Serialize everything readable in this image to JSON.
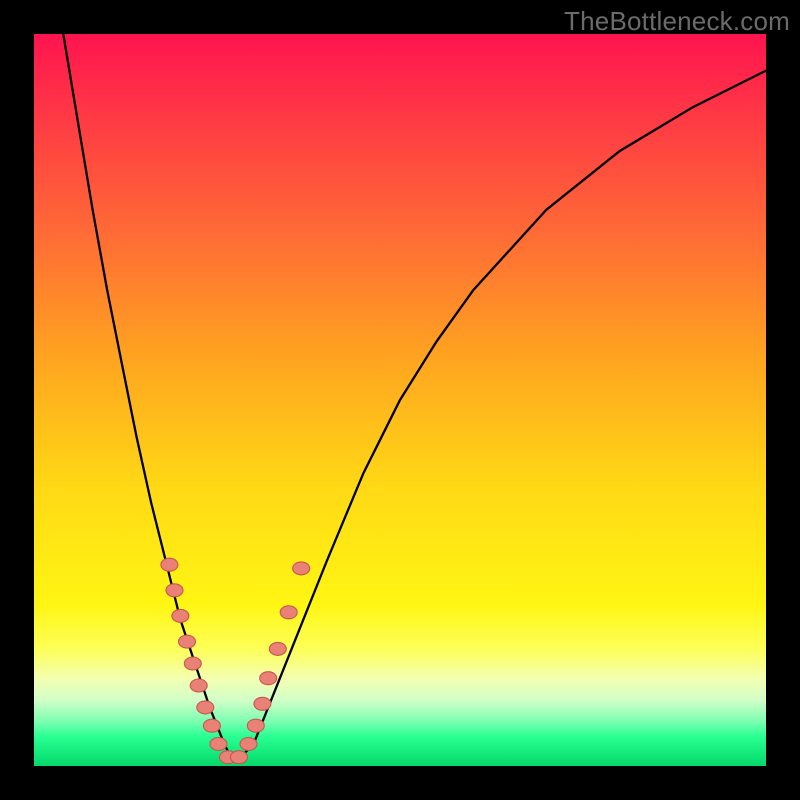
{
  "watermark": "TheBottleneck.com",
  "colors": {
    "frame": "#000000",
    "gradient_top": "#ff144f",
    "gradient_bottom": "#04d86a",
    "curve": "#000000",
    "bead_fill": "#e98177",
    "bead_stroke": "#c4584f"
  },
  "chart_data": {
    "type": "line",
    "title": "",
    "xlabel": "",
    "ylabel": "",
    "xlim": [
      0,
      100
    ],
    "ylim": [
      0,
      100
    ],
    "notes": "V-shaped bottleneck curve. y-axis = mismatch/bottleneck percentage (higher = worse, background red at top, green at bottom). x-axis = relative component performance (unlabeled). Minimum (~0%) occurs near x≈27. Beads mark sampled configurations clustered around the minimum.",
    "series": [
      {
        "name": "bottleneck-curve",
        "x": [
          4,
          6,
          8,
          10,
          12,
          14,
          16,
          18,
          20,
          22,
          24,
          26,
          27,
          28,
          30,
          32,
          36,
          40,
          45,
          50,
          55,
          60,
          70,
          80,
          90,
          100
        ],
        "y": [
          100,
          88,
          76,
          65,
          55,
          45,
          36,
          28,
          20,
          14,
          8,
          3,
          1,
          1,
          3,
          8,
          18,
          28,
          40,
          50,
          58,
          65,
          76,
          84,
          90,
          95
        ]
      }
    ],
    "bead_points": {
      "name": "sampled-configs",
      "x": [
        18.5,
        19.2,
        20.0,
        20.9,
        21.7,
        22.5,
        23.4,
        24.3,
        25.2,
        26.5,
        28.0,
        29.3,
        30.3,
        31.2,
        32.0,
        33.3,
        34.8,
        36.5
      ],
      "y": [
        27.5,
        24.0,
        20.5,
        17.0,
        14.0,
        11.0,
        8.0,
        5.5,
        3.0,
        1.2,
        1.2,
        3.0,
        5.5,
        8.5,
        12.0,
        16.0,
        21.0,
        27.0
      ]
    }
  }
}
